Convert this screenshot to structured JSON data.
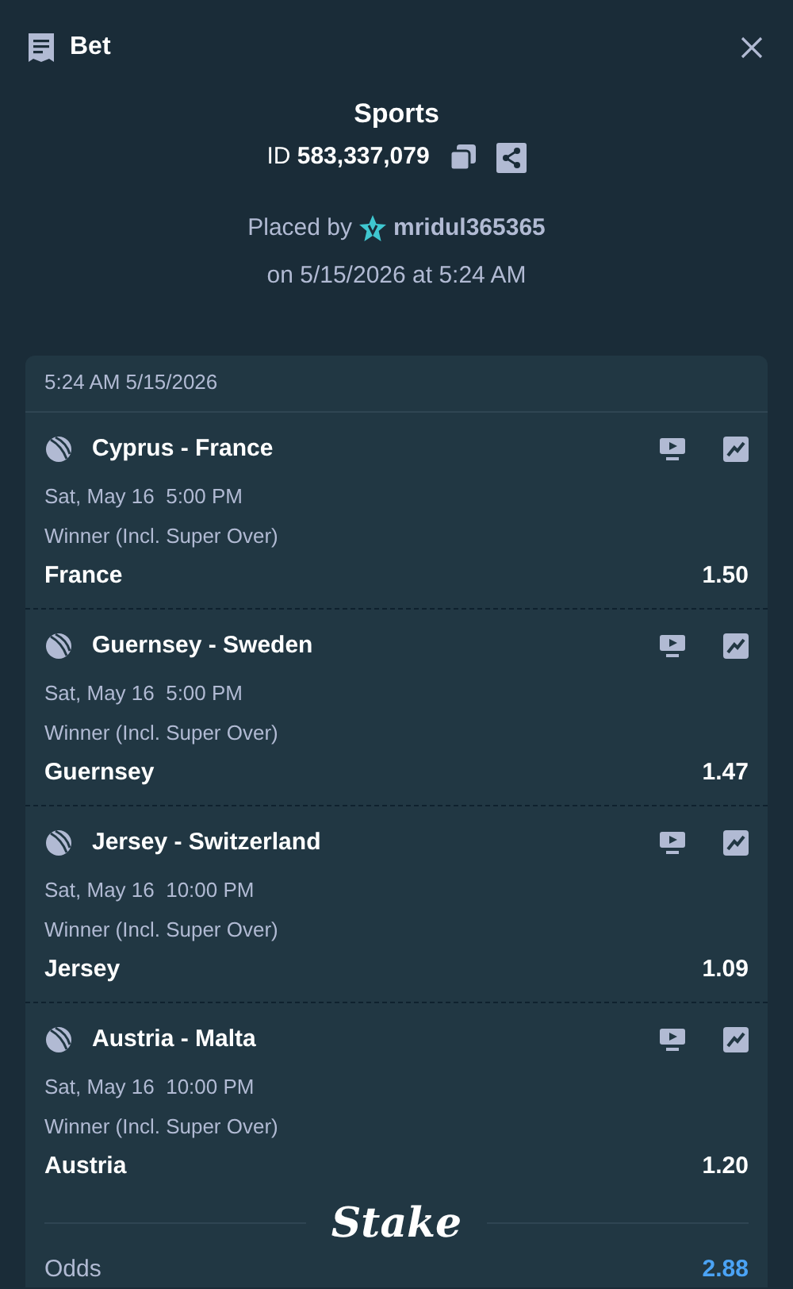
{
  "header": {
    "title": "Bet"
  },
  "summary": {
    "category": "Sports",
    "id_label": "ID",
    "id_value": "583,337,079",
    "placed_by_label": "Placed by",
    "username": "mridul365365",
    "placed_on": "on 5/15/2026 at 5:24 AM"
  },
  "slip": {
    "timestamp": "5:24 AM 5/15/2026",
    "legs": [
      {
        "match": "Cyprus - France",
        "date": "Sat, May 16  5:00 PM",
        "market": "Winner (Incl. Super Over)",
        "selection": "France",
        "odds": "1.50"
      },
      {
        "match": "Guernsey - Sweden",
        "date": "Sat, May 16  5:00 PM",
        "market": "Winner (Incl. Super Over)",
        "selection": "Guernsey",
        "odds": "1.47"
      },
      {
        "match": "Jersey - Switzerland",
        "date": "Sat, May 16  10:00 PM",
        "market": "Winner (Incl. Super Over)",
        "selection": "Jersey",
        "odds": "1.09"
      },
      {
        "match": "Austria - Malta",
        "date": "Sat, May 16  10:00 PM",
        "market": "Winner (Incl. Super Over)",
        "selection": "Austria",
        "odds": "1.20"
      }
    ],
    "brand": "Stake",
    "odds_label": "Odds",
    "total_odds": "2.88"
  }
}
